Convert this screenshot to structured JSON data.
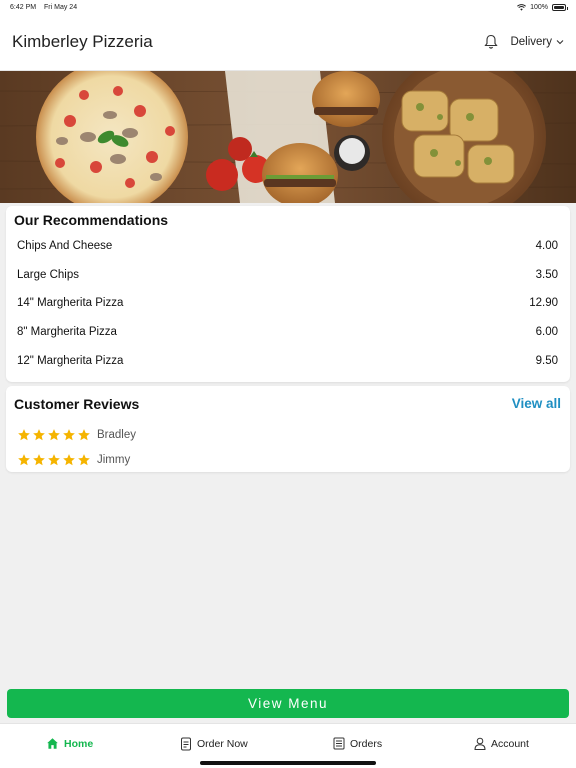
{
  "status_bar": {
    "time": "6:42 PM",
    "date": "Fri May 24",
    "battery": "100%"
  },
  "header": {
    "title": "Kimberley Pizzeria",
    "delivery_label": "Delivery"
  },
  "recommendations": {
    "title": "Our Recommendations",
    "items": [
      {
        "name": "Chips And Cheese",
        "price": "4.00"
      },
      {
        "name": "Large Chips",
        "price": "3.50"
      },
      {
        "name": "14\" Margherita Pizza",
        "price": "12.90"
      },
      {
        "name": "8\" Margherita Pizza",
        "price": "6.00"
      },
      {
        "name": "12\" Margherita Pizza",
        "price": "9.50"
      }
    ]
  },
  "reviews": {
    "title": "Customer Reviews",
    "view_all": "View all",
    "items": [
      {
        "name": "Bradley",
        "rating": 5
      },
      {
        "name": "Jimmy",
        "rating": 5
      }
    ]
  },
  "view_menu": "View Menu",
  "tabs": [
    {
      "label": "Home",
      "icon": "home-icon",
      "active": true
    },
    {
      "label": "Order Now",
      "icon": "order-icon",
      "active": false
    },
    {
      "label": "Orders",
      "icon": "orders-icon",
      "active": false
    },
    {
      "label": "Account",
      "icon": "account-icon",
      "active": false
    }
  ],
  "colors": {
    "accent": "#14b74f",
    "link": "#1f8fc2",
    "star": "#f5b400"
  }
}
